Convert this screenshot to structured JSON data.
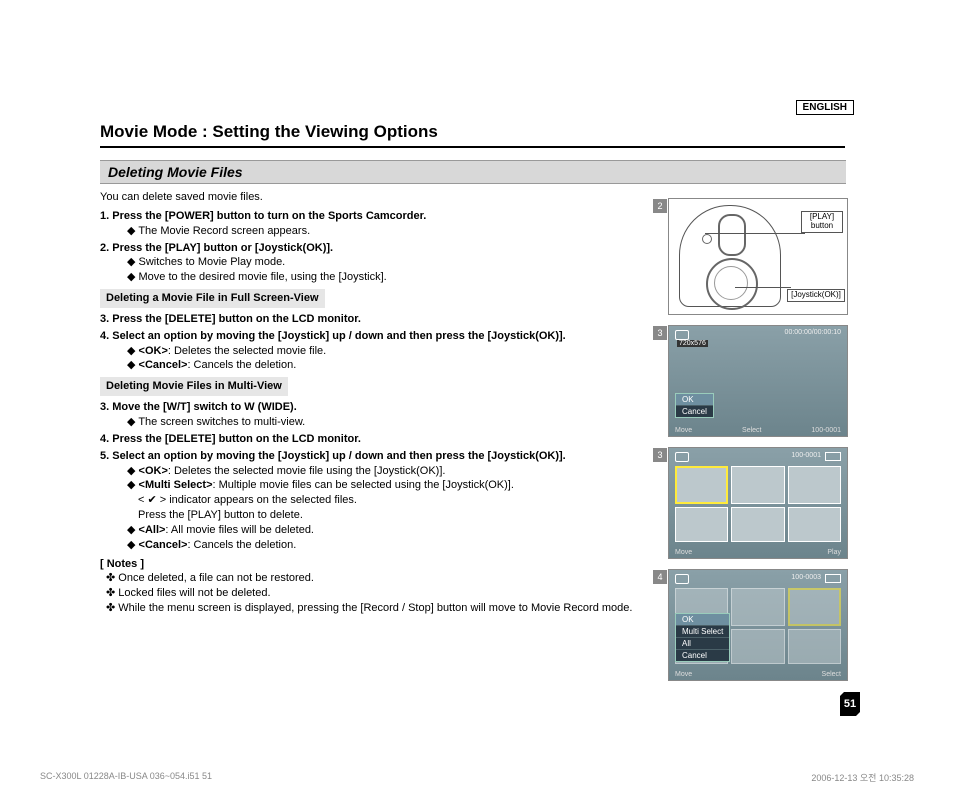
{
  "lang": "ENGLISH",
  "title": "Movie Mode : Setting the Viewing Options",
  "subtitle": "Deleting Movie Files",
  "intro": "You can delete saved movie files.",
  "step1": "1.  Press the [POWER] button to turn on the Sports Camcorder.",
  "step1_b1": "◆   The Movie Record screen appears.",
  "step2": "2.  Press the [PLAY] button or [Joystick(OK)].",
  "step2_b1": "◆   Switches to Movie Play mode.",
  "step2_b2": "◆   Move to the desired movie file, using the [Joystick].",
  "subbar1": "Deleting a Movie File in Full Screen-View",
  "step3a": "3.  Press the [DELETE] button on the LCD monitor.",
  "step4a": "4.  Select an option by moving the [Joystick] up / down and then press the [Joystick(OK)].",
  "s4a_b1_pre": "◆   ",
  "s4a_b1_b": "<OK>",
  "s4a_b1_post": ": Deletes the selected movie file.",
  "s4a_b2_pre": "◆   ",
  "s4a_b2_b": "<Cancel>",
  "s4a_b2_post": ": Cancels the deletion.",
  "subbar2": "Deleting Movie Files in Multi-View",
  "step3b": "3.  Move the [W/T] switch to W (WIDE).",
  "s3b_b1": "◆   The screen switches to multi-view.",
  "step4b": "4.  Press the [DELETE] button on the LCD monitor.",
  "step5b": "5.  Select an option by moving the [Joystick] up / down and then press the [Joystick(OK)].",
  "s5_b1_pre": "◆   ",
  "s5_b1_b": "<OK>",
  "s5_b1_post": ": Deletes the selected movie file using the [Joystick(OK)].",
  "s5_b2_pre": "◆   ",
  "s5_b2_b": "<Multi Select>",
  "s5_b2_post": ": Multiple movie files can be selected using the [Joystick(OK)].",
  "s5_b2_cont1": "< ✔ > indicator appears on the selected files.",
  "s5_b2_cont2": "Press the [PLAY] button to delete.",
  "s5_b3_pre": "◆   ",
  "s5_b3_b": "<All>",
  "s5_b3_post": ": All movie files will be deleted.",
  "s5_b4_pre": "◆   ",
  "s5_b4_b": "<Cancel>",
  "s5_b4_post": ": Cancels the deletion.",
  "notes_head": "[ Notes ]",
  "note1": "✤   Once deleted, a file can not be restored.",
  "note2": "✤   Locked files will not be deleted.",
  "note3": "✤   While the menu screen is displayed, pressing the [Record / Stop] button will move to Movie Record mode.",
  "fig2": {
    "num": "2",
    "play": "[PLAY] button",
    "joy": "[Joystick(OK)]"
  },
  "fig3a": {
    "num": "3",
    "top": "00:00:00/00:00:10",
    "res": "720x576",
    "file": "100-0001",
    "move": "Move",
    "select": "Select",
    "menu": [
      "OK",
      "Cancel"
    ]
  },
  "fig3b": {
    "num": "3",
    "file": "100-0001",
    "move": "Move",
    "play": "Play"
  },
  "fig4": {
    "num": "4",
    "file": "100-0003",
    "move": "Move",
    "select": "Select",
    "menu": [
      "OK",
      "Multi Select",
      "All",
      "Cancel"
    ]
  },
  "page_num": "51",
  "footer_left": "SC-X300L 01228A-IB-USA 036~054.i51   51",
  "footer_right": "2006-12-13   오전 10:35:28"
}
